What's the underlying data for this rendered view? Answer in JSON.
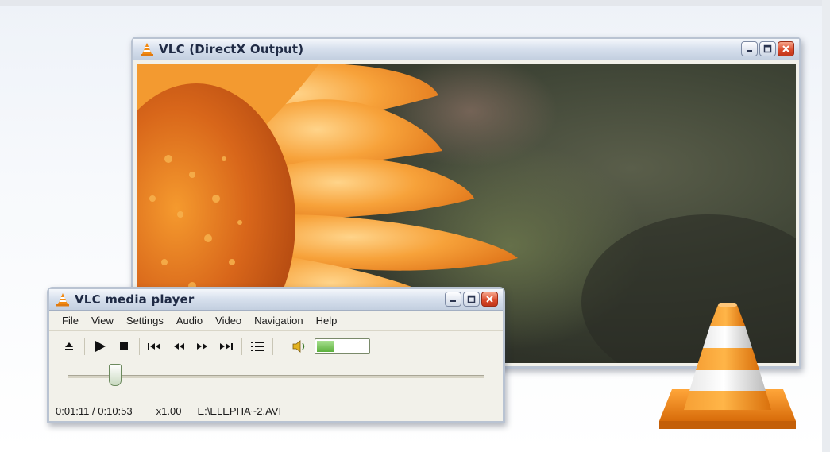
{
  "video_window": {
    "title": "VLC (DirectX Output)"
  },
  "player_window": {
    "title": "VLC media player",
    "menu": [
      "File",
      "View",
      "Settings",
      "Audio",
      "Video",
      "Navigation",
      "Help"
    ],
    "toolbar_icons": [
      "eject-icon",
      "play-icon",
      "stop-icon",
      "previous-icon",
      "rewind-icon",
      "fast-forward-icon",
      "next-icon",
      "playlist-icon",
      "speaker-icon"
    ],
    "volume_level": 0.35,
    "seek_position": 0.11,
    "status": {
      "time": "0:01:11 / 0:10:53",
      "speed": "x1.00",
      "file": "E:\\ELEPHA~2.AVI"
    }
  },
  "colors": {
    "accent_orange": "#f28a12",
    "close_red": "#d9492a",
    "volume_green": "#5cb03c"
  }
}
